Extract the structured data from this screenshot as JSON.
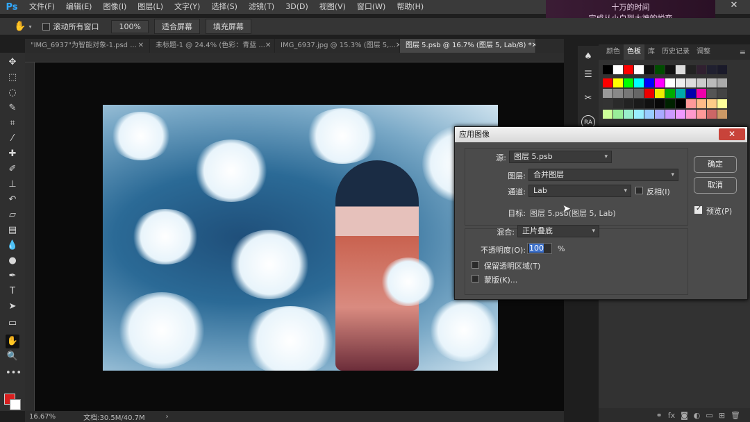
{
  "app": {
    "logo": "Ps"
  },
  "menu": [
    "文件(F)",
    "编辑(E)",
    "图像(I)",
    "图层(L)",
    "文字(Y)",
    "选择(S)",
    "滤镜(T)",
    "3D(D)",
    "视图(V)",
    "窗口(W)",
    "帮助(H)"
  ],
  "banner": {
    "line1": "十万的时间",
    "line2": "完成从小白到大神的蜕变"
  },
  "options": {
    "scroll_all_label": "滚动所有窗口",
    "zoom": "100%",
    "fit_screen": "适合屏幕",
    "fill_screen": "填充屏幕"
  },
  "tabs": [
    {
      "label": "\"IMG_6937\"为智能对象-1.psd ..."
    },
    {
      "label": "未标题-1 @ 24.4% (色彩：青蓝 ..."
    },
    {
      "label": "IMG_6937.jpg @ 15.3% (图层 5,..."
    },
    {
      "label": "图层 5.psb @ 16.7% (图层 5, Lab/8) *"
    }
  ],
  "status": {
    "zoom": "16.67%",
    "doc": "文档:30.5M/40.7M"
  },
  "panel": {
    "tabs": [
      "颜色",
      "色板",
      "库",
      "历史记录",
      "调整"
    ]
  },
  "colors": {
    "foreground": "#d81f1f",
    "background": "#ffffff"
  },
  "dialog": {
    "title": "应用图像",
    "source_label": "源:",
    "source_value": "图层 5.psb",
    "layer_label": "图层:",
    "layer_value": "合并图层",
    "channel_label": "通道:",
    "channel_value": "Lab",
    "invert_label": "反相(I)",
    "target_label": "目标:",
    "target_value": "图层 5.psb(图层 5, Lab)",
    "blend_label": "混合:",
    "blend_value": "正片叠底",
    "opacity_label": "不透明度(O):",
    "opacity_value": "100",
    "opacity_unit": "%",
    "preserve_label": "保留透明区域(T)",
    "mask_label": "蒙版(K)...",
    "ok_label": "确定",
    "cancel_label": "取消",
    "preview_label": "预览(P)",
    "preview_checked": true
  }
}
